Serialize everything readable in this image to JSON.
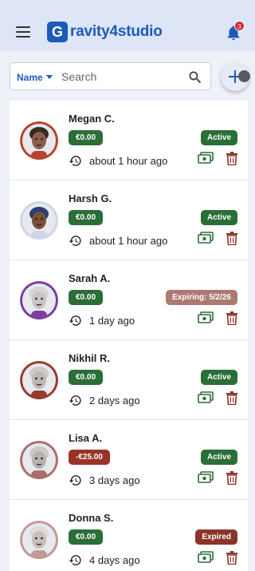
{
  "app": {
    "logo_letter": "G",
    "brand": "ravity4studio",
    "notification_count": "3"
  },
  "search": {
    "field": "Name",
    "placeholder": "Search",
    "value": ""
  },
  "colors": {
    "active": "#2b6e37",
    "expiring": "#ac7a73",
    "expired": "#8b3428",
    "balance_positive": "#2b6e37",
    "balance_negative": "#9a3327",
    "brand": "#1e5bb8"
  },
  "users": [
    {
      "name": "Megan C.",
      "balance": "€0.00",
      "balance_kind": "positive",
      "status": "Active",
      "status_kind": "active",
      "time": "about 1 hour ago",
      "avatar_bg": "#b8432f",
      "skin": "#8a5f4c",
      "hair": "#3b2a22"
    },
    {
      "name": "Harsh G.",
      "balance": "€0.00",
      "balance_kind": "positive",
      "status": "Active",
      "status_kind": "active",
      "time": "about 1 hour ago",
      "avatar_bg": "#cfd6e6",
      "skin": "#7a5039",
      "hair": "#2b3f78"
    },
    {
      "name": "Sarah A.",
      "balance": "€0.00",
      "balance_kind": "positive",
      "status": "Expiring: 5/2/26",
      "status_kind": "expiring",
      "time": "1 day ago",
      "avatar_bg": "#7a3ea0",
      "skin": "#c9c4c4",
      "hair": "#d7d4d4"
    },
    {
      "name": "Nikhil R.",
      "balance": "€0.00",
      "balance_kind": "positive",
      "status": "Active",
      "status_kind": "active",
      "time": "2 days ago",
      "avatar_bg": "#9a3a2f",
      "skin": "#bdb8b6",
      "hair": "#cfcaca"
    },
    {
      "name": "Lisa A.",
      "balance": "-€25.00",
      "balance_kind": "negative",
      "status": "Active",
      "status_kind": "active",
      "time": "3 days ago",
      "avatar_bg": "#a8716a",
      "skin": "#b7b2b0",
      "hair": "#d0c8c6"
    },
    {
      "name": "Donna S.",
      "balance": "€0.00",
      "balance_kind": "positive",
      "status": "Expired",
      "status_kind": "expired",
      "time": "4 days ago",
      "avatar_bg": "#c29a92",
      "skin": "#c7bdb9",
      "hair": "#e1dad8"
    }
  ]
}
